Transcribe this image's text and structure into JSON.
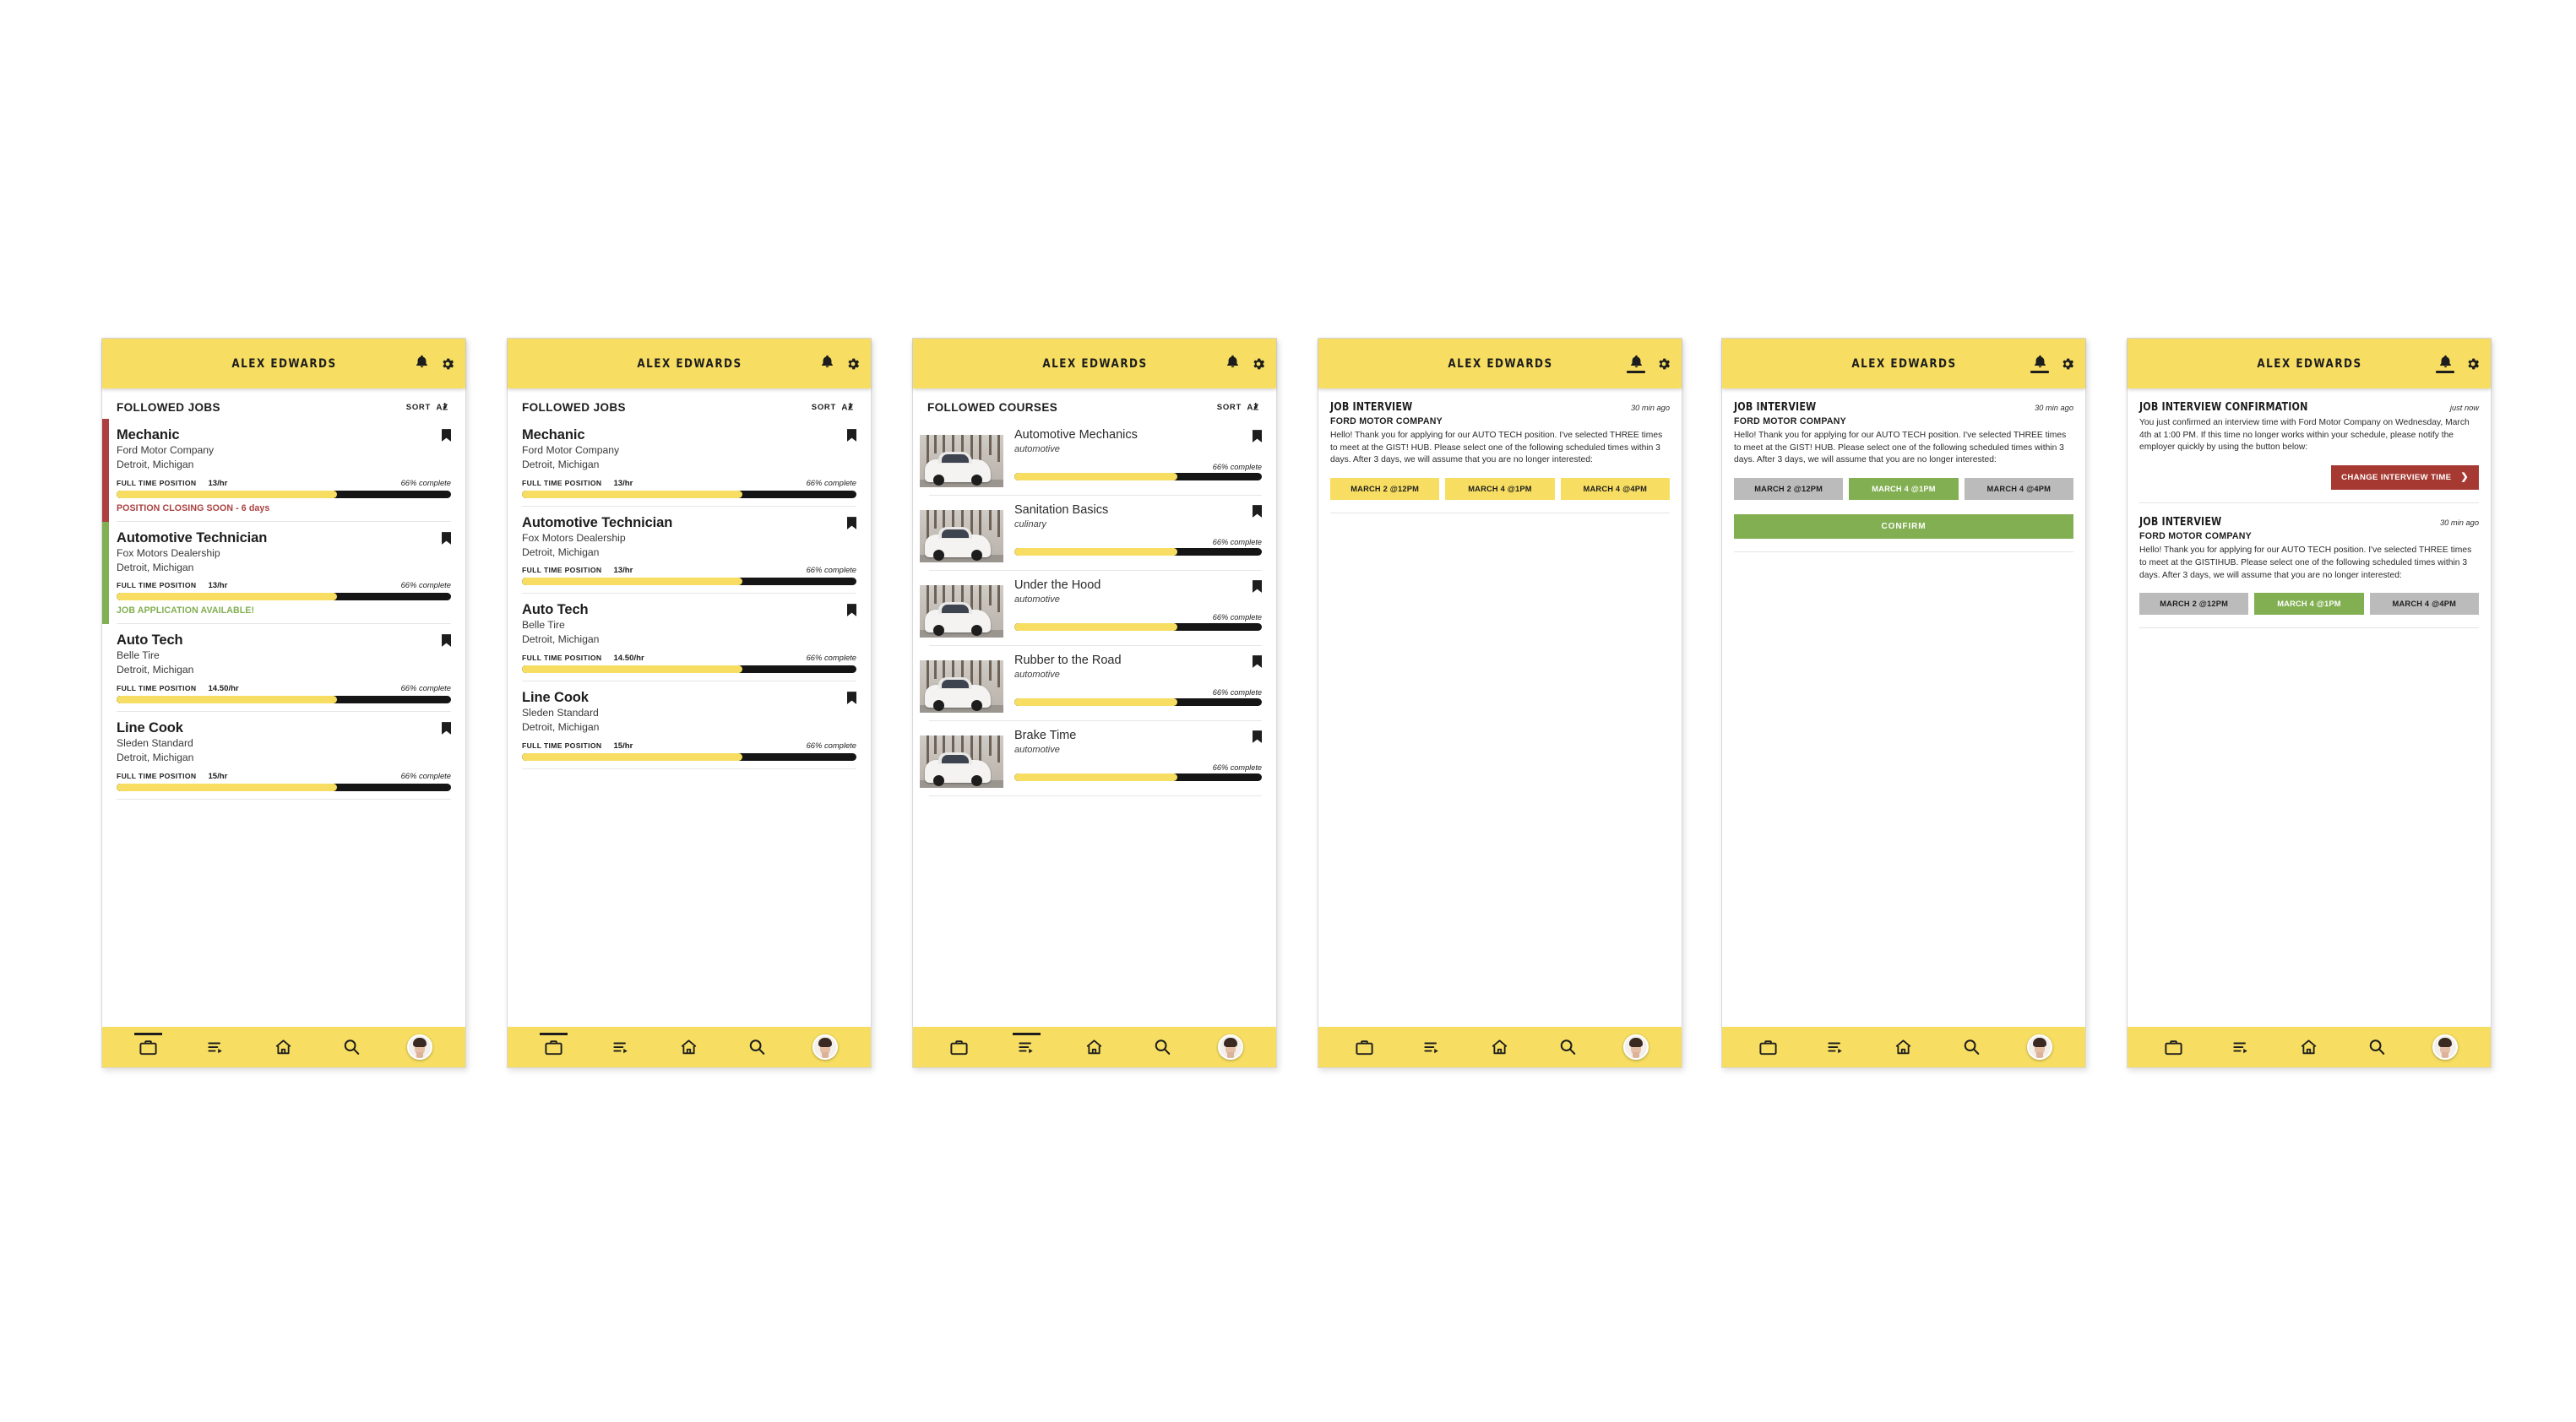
{
  "header": {
    "title": "Alex Edwards",
    "bell_icon": "bell-icon",
    "gear_icon": "gear-icon"
  },
  "sort": {
    "label": "SORT",
    "icon": "sort-az-icon"
  },
  "nav": {
    "items": [
      {
        "name": "briefcase",
        "icon": "briefcase-icon"
      },
      {
        "name": "courses",
        "icon": "playlist-icon"
      },
      {
        "name": "home",
        "icon": "home-icon"
      },
      {
        "name": "search",
        "icon": "search-icon"
      },
      {
        "name": "profile",
        "icon": "avatar-icon"
      }
    ]
  },
  "screens": [
    {
      "id": "followed-jobs-status",
      "section_title": "FOLLOWED JOBS",
      "active_nav": 0,
      "bell_active": false,
      "jobs": [
        {
          "title": "Mechanic",
          "company": "Ford Motor Company",
          "location": "Detroit, Michigan",
          "type": "FULL TIME POSITION",
          "wage": "13/hr",
          "progress_label": "66% complete",
          "progress": 66,
          "strip": "red",
          "status": "POSITION CLOSING SOON - 6 days",
          "status_color": "red"
        },
        {
          "title": "Automotive Technician",
          "company": "Fox Motors Dealership",
          "location": "Detroit, Michigan",
          "type": "FULL TIME POSITION",
          "wage": "13/hr",
          "progress_label": "66% complete",
          "progress": 66,
          "strip": "green",
          "status": "JOB APPLICATION AVAILABLE!",
          "status_color": "green"
        },
        {
          "title": "Auto Tech",
          "company": "Belle Tire",
          "location": "Detroit, Michigan",
          "type": "FULL TIME POSITION",
          "wage": "14.50/hr",
          "progress_label": "66% complete",
          "progress": 66,
          "strip": "none",
          "status": "",
          "status_color": ""
        },
        {
          "title": "Line Cook",
          "company": "Sleden Standard",
          "location": "Detroit, Michigan",
          "type": "FULL TIME POSITION",
          "wage": "15/hr",
          "progress_label": "66% complete",
          "progress": 66,
          "strip": "none",
          "status": "",
          "status_color": ""
        }
      ]
    },
    {
      "id": "followed-jobs-plain",
      "section_title": "FOLLOWED JOBS",
      "active_nav": 0,
      "bell_active": false,
      "jobs": [
        {
          "title": "Mechanic",
          "company": "Ford Motor Company",
          "location": "Detroit, Michigan",
          "type": "FULL TIME POSITION",
          "wage": "13/hr",
          "progress_label": "66% complete",
          "progress": 66,
          "strip": "none",
          "status": "",
          "status_color": ""
        },
        {
          "title": "Automotive Technician",
          "company": "Fox Motors Dealership",
          "location": "Detroit, Michigan",
          "type": "FULL TIME POSITION",
          "wage": "13/hr",
          "progress_label": "66% complete",
          "progress": 66,
          "strip": "none",
          "status": "",
          "status_color": ""
        },
        {
          "title": "Auto Tech",
          "company": "Belle Tire",
          "location": "Detroit, Michigan",
          "type": "FULL TIME POSITION",
          "wage": "14.50/hr",
          "progress_label": "66% complete",
          "progress": 66,
          "strip": "none",
          "status": "",
          "status_color": ""
        },
        {
          "title": "Line Cook",
          "company": "Sleden Standard",
          "location": "Detroit, Michigan",
          "type": "FULL TIME POSITION",
          "wage": "15/hr",
          "progress_label": "66% complete",
          "progress": 66,
          "strip": "none",
          "status": "",
          "status_color": ""
        }
      ]
    },
    {
      "id": "followed-courses",
      "section_title": "FOLLOWED COURSES",
      "active_nav": 1,
      "bell_active": false,
      "courses": [
        {
          "title": "Automotive Mechanics",
          "category": "automotive",
          "progress_label": "66% complete",
          "progress": 66
        },
        {
          "title": "Sanitation Basics",
          "category": "culinary",
          "progress_label": "66% complete",
          "progress": 66
        },
        {
          "title": "Under the Hood",
          "category": "automotive",
          "progress_label": "66% complete",
          "progress": 66
        },
        {
          "title": "Rubber to the Road",
          "category": "automotive",
          "progress_label": "66% complete",
          "progress": 66
        },
        {
          "title": "Brake Time",
          "category": "automotive",
          "progress_label": "66% complete",
          "progress": 66
        }
      ]
    },
    {
      "id": "job-interview-unselected",
      "active_nav": -1,
      "bell_active": true,
      "notifications": [
        {
          "title": "JOB INTERVIEW",
          "time": "30 min ago",
          "org": "FORD MOTOR COMPANY",
          "body": "Hello! Thank you for applying for our AUTO TECH position. I've selected THREE times to meet at the GIST! HUB. Please select one of the following scheduled times within 3 days. After 3 days, we will assume that you are no longer interested:",
          "chips": [
            {
              "label": "MARCH 2 @12PM",
              "state": "yellow"
            },
            {
              "label": "MARCH 4 @1PM",
              "state": "yellow"
            },
            {
              "label": "MARCH 4 @4PM",
              "state": "yellow"
            }
          ],
          "confirm": null
        }
      ]
    },
    {
      "id": "job-interview-selected",
      "active_nav": -1,
      "bell_active": true,
      "notifications": [
        {
          "title": "JOB INTERVIEW",
          "time": "30 min ago",
          "org": "FORD MOTOR COMPANY",
          "body": "Hello! Thank you for applying for our AUTO TECH position. I've selected THREE times to meet at the GIST! HUB. Please select one of the following scheduled times within 3 days. After 3 days, we will assume that you are no longer interested:",
          "chips": [
            {
              "label": "MARCH 2 @12PM",
              "state": "grey"
            },
            {
              "label": "MARCH 4 @1PM",
              "state": "green"
            },
            {
              "label": "MARCH 4 @4PM",
              "state": "grey"
            }
          ],
          "confirm": "CONFIRM"
        }
      ]
    },
    {
      "id": "job-interview-confirmation",
      "active_nav": -1,
      "bell_active": true,
      "notifications": [
        {
          "title": "JOB INTERVIEW CONFIRMATION",
          "time": "just now",
          "org": null,
          "body": "You just confirmed an interview time with Ford Motor Company on Wednesday, March 4th at 1:00 PM. If this time no longer works within your schedule, please notify the employer quickly by using the button below:",
          "chips": [],
          "confirm": null,
          "change_button": {
            "label": "CHANGE INTERVIEW TIME",
            "icon": "chevron-right-icon"
          }
        },
        {
          "title": "JOB INTERVIEW",
          "time": "30 min ago",
          "org": "FORD MOTOR COMPANY",
          "body": "Hello! Thank you for applying for our AUTO TECH position. I've selected THREE times to meet at the GISTIHUB. Please select one of the following scheduled times within 3 days. After 3 days, we will assume that you are no longer interested:",
          "chips": [
            {
              "label": "MARCH 2 @12PM",
              "state": "grey"
            },
            {
              "label": "MARCH 4 @1PM",
              "state": "green"
            },
            {
              "label": "MARCH 4 @4PM",
              "state": "grey"
            }
          ],
          "confirm": null
        }
      ]
    }
  ],
  "colors": {
    "yellow": "#F7DE62",
    "green": "#82AF51",
    "red": "#AC4040",
    "dark_red": "#A63A33",
    "grey": "#BBBBBB",
    "black": "#151515"
  }
}
